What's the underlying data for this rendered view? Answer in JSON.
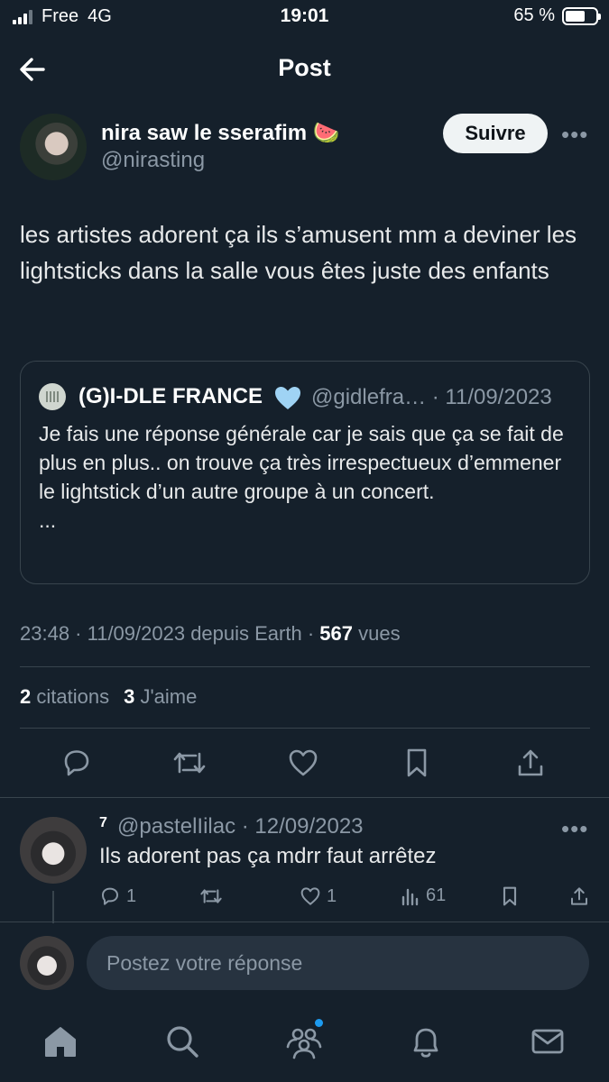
{
  "status_bar": {
    "carrier": "Free",
    "network": "4G",
    "time": "19:01",
    "battery_text": "65 %",
    "battery_level": 0.65
  },
  "header": {
    "title": "Post",
    "back_icon": "back-arrow-icon"
  },
  "post": {
    "author_name": "nira saw le sserafim 🍉",
    "author_handle": "@nirasting",
    "follow_label": "Suivre",
    "more_label": "•••",
    "text": "les artistes adorent ça ils s’amusent mm a deviner les lightsticks dans la salle vous êtes juste des enfants",
    "quote": {
      "author_name": "(G)I-DLE FRANCE",
      "author_handle": "@gidlefra… · 11/09/2023",
      "text": "Je fais une réponse générale car je sais que ça se fait de plus en plus.. on trouve ça très irrespectueux d’emmener le lightstick d’un autre groupe à un concert.",
      "ellipsis": "..."
    },
    "meta_time": "23:48 · 11/09/2023 depuis Earth · ",
    "views_count": "567",
    "views_label": "vues",
    "citations_count": "2",
    "citations_label": "citations",
    "likes_count": "3",
    "likes_label": "J'aime"
  },
  "reply": {
    "rank": "7",
    "header": "@pastelIilac · 12/09/2023",
    "text": "Ils adorent pas ça mdrr faut arrêtez",
    "reply_count": "1",
    "like_count": "1",
    "view_count": "61"
  },
  "composer": {
    "placeholder": "Postez votre réponse"
  },
  "tabs": [
    "home-icon",
    "search-icon",
    "communities-icon",
    "notifications-icon",
    "messages-icon"
  ],
  "colors": {
    "background": "#15202b",
    "accent": "#1d9bf0",
    "muted": "#8b98a5",
    "border": "#38444d"
  }
}
